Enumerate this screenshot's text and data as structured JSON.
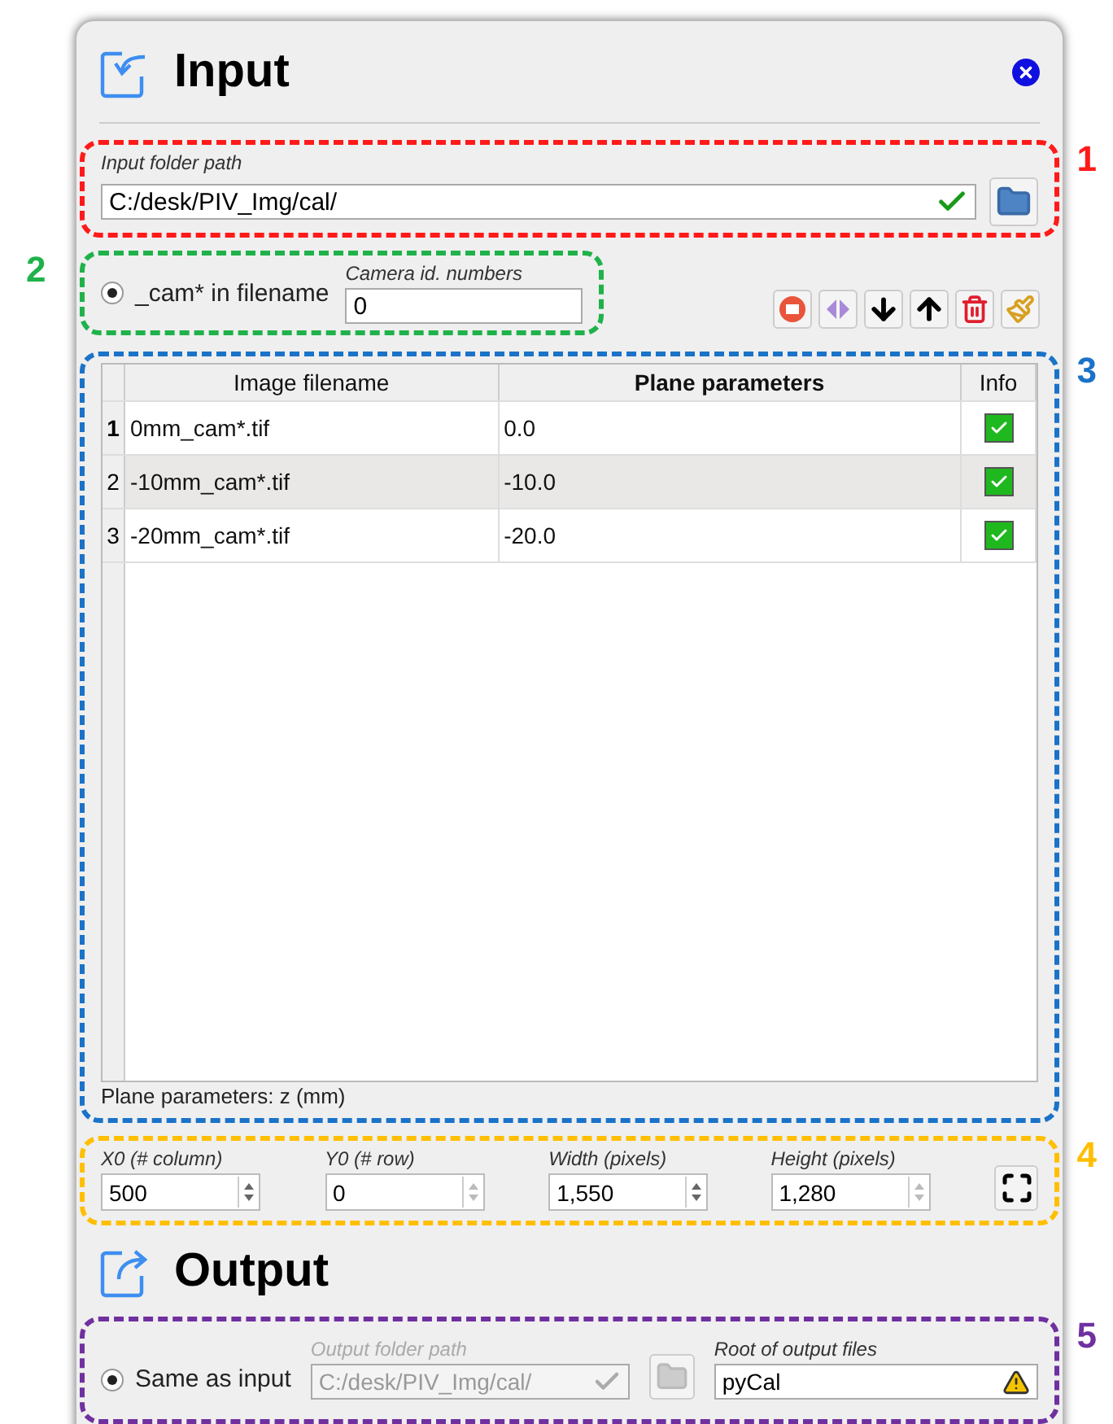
{
  "input": {
    "title": "Input",
    "folder": {
      "label": "Input folder path",
      "value": "C:/desk/PIV_Img/cal/",
      "valid": true
    },
    "camera": {
      "option": {
        "label": "_cam* in filename",
        "selected": true
      },
      "label": "Camera id. numbers",
      "value": "0"
    },
    "table": {
      "columns": [
        "Image filename",
        "Plane parameters",
        "Info"
      ],
      "rows": [
        {
          "index": "1",
          "filename": "0mm_cam*.tif",
          "plane": "0.0",
          "info": true,
          "current": true,
          "selected": false
        },
        {
          "index": "2",
          "filename": "-10mm_cam*.tif",
          "plane": "-10.0",
          "info": true,
          "current": false,
          "selected": true
        },
        {
          "index": "3",
          "filename": "-20mm_cam*.tif",
          "plane": "-20.0",
          "info": true,
          "current": false,
          "selected": false
        }
      ],
      "caption": "Plane parameters: z (mm)"
    },
    "roi": [
      {
        "label": "X0 (# column)",
        "value": "500",
        "disabled": false
      },
      {
        "label": "Y0 (# row)",
        "value": "0",
        "disabled": true
      },
      {
        "label": "Width (pixels)",
        "value": "1,550",
        "disabled": false
      },
      {
        "label": "Height (pixels)",
        "value": "1,280",
        "disabled": true
      }
    ]
  },
  "output": {
    "title": "Output",
    "same_as_input": {
      "label": "Same as input",
      "selected": true
    },
    "folder": {
      "label": "Output folder path",
      "value": "C:/desk/PIV_Img/cal/",
      "disabled": true
    },
    "root": {
      "label": "Root of output files",
      "value": "pyCal",
      "warning": true
    }
  },
  "annotations": [
    {
      "number": "1",
      "color": "#ff1a1a"
    },
    {
      "number": "2",
      "color": "#1fb24a"
    },
    {
      "number": "3",
      "color": "#1a73c8"
    },
    {
      "number": "4",
      "color": "#ffbf00"
    },
    {
      "number": "5",
      "color": "#7030a0"
    }
  ]
}
